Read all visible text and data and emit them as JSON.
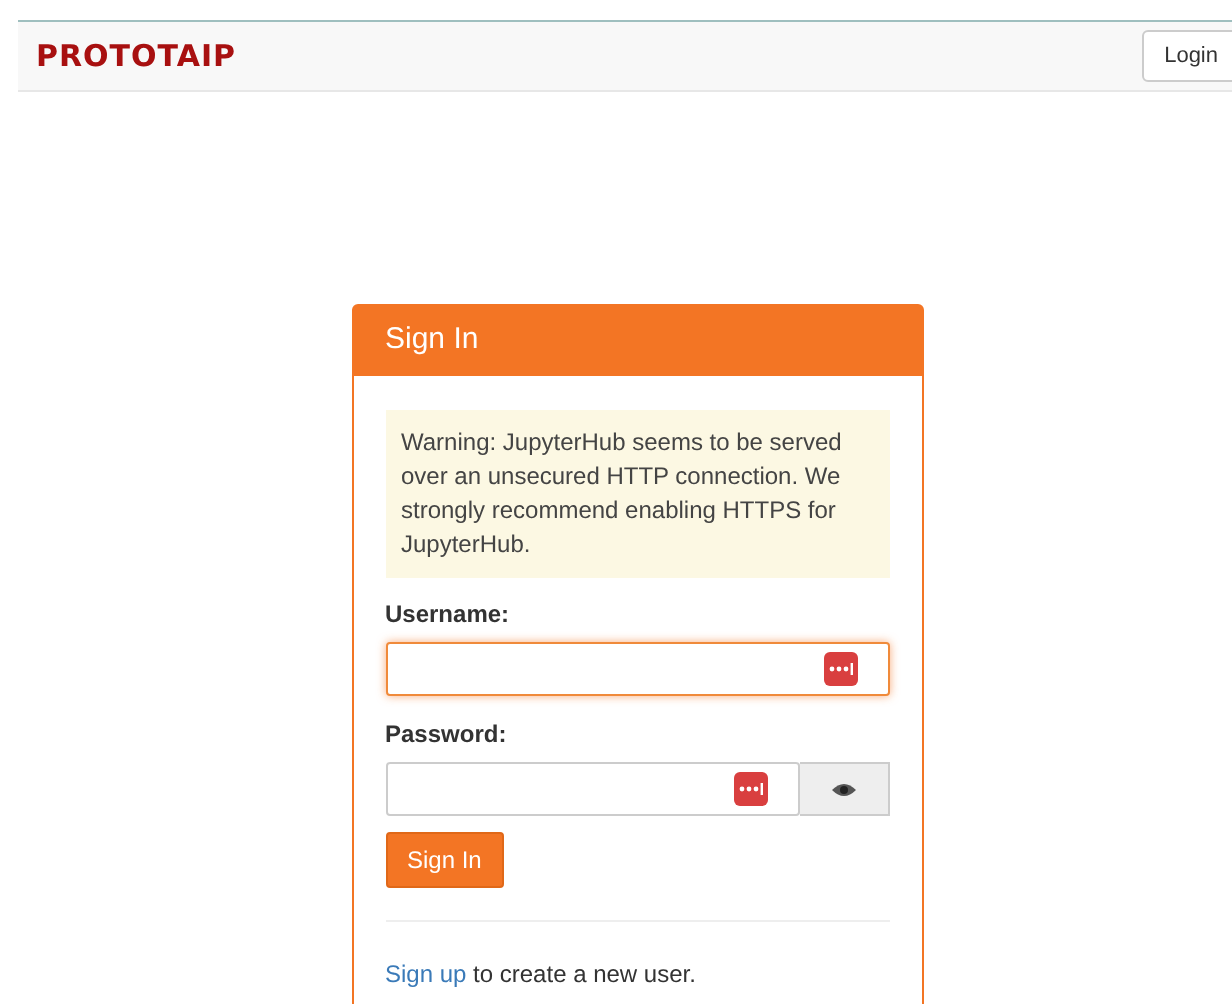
{
  "navbar": {
    "logo": "PROTOTAIP",
    "login_button": "Login"
  },
  "panel": {
    "title": "Sign In",
    "warning": "Warning: JupyterHub seems to be served over an unsecured HTTP connection. We strongly recommend enabling HTTPS for JupyterHub.",
    "fields": [
      {
        "kind": "text",
        "label": "Username:",
        "focused": true
      },
      {
        "kind": "password",
        "label": "Password:",
        "focused": false
      }
    ],
    "submit_button": "Sign In",
    "signup_link": "Sign up",
    "signup_text": "to create a new user."
  }
}
